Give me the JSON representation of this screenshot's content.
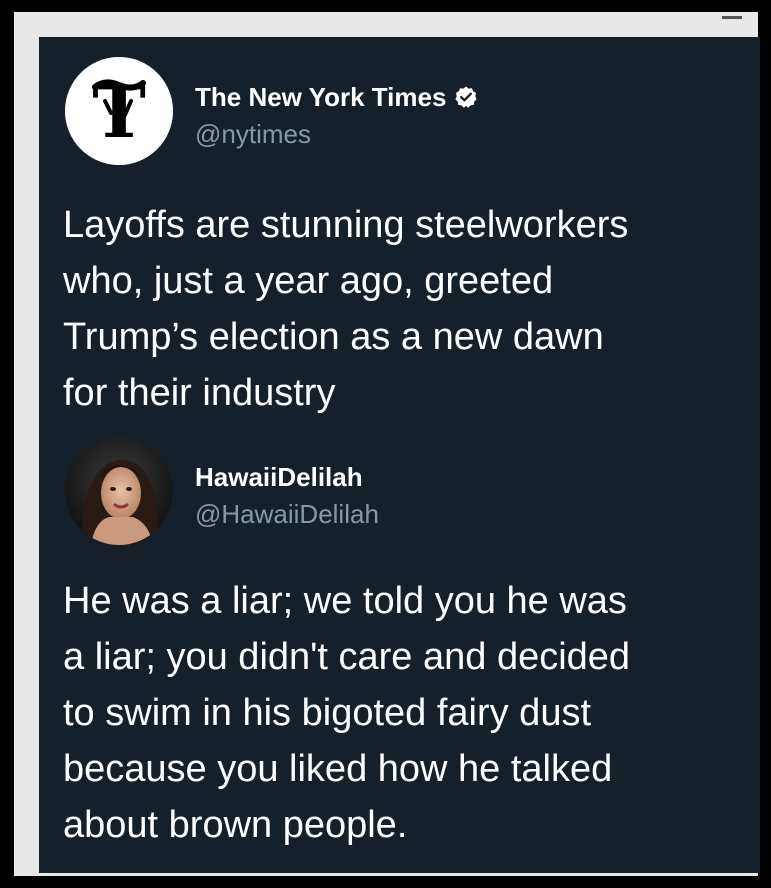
{
  "tweets": [
    {
      "author": {
        "display_name": "The New York Times",
        "handle": "@nytimes",
        "verified": true,
        "avatar_icon": "nyt-logo-icon"
      },
      "text_lines": [
        "Layoffs are stunning steelworkers",
        "who, just a year ago, greeted",
        "Trump’s election as a new dawn",
        "for their industry"
      ]
    },
    {
      "author": {
        "display_name": "HawaiiDelilah",
        "handle": "@HawaiiDelilah",
        "verified": false,
        "avatar_icon": "user-photo-avatar"
      },
      "text_lines": [
        "He was a liar; we told you he was",
        "a liar; you didn't care and decided",
        "to swim in his bigoted fairy dust",
        "because you liked how he talked",
        "about brown people."
      ]
    }
  ],
  "colors": {
    "background": "#15202b",
    "text_primary": "#ffffff",
    "text_secondary": "#8899a6",
    "frame": "#000000",
    "verified_badge": "#ffffff"
  }
}
